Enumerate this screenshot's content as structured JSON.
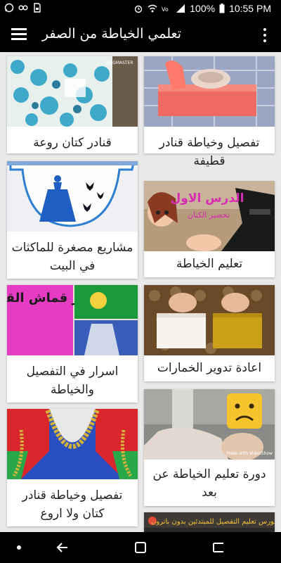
{
  "status_bar": {
    "time": "10:55 PM",
    "battery": "100%",
    "notification_icons": [
      "whatsapp-icon",
      "infinity-icon",
      "sim-card-icon",
      "alarm-icon",
      "wifi-icon",
      "volte-icon",
      "signal-icon",
      "battery-icon"
    ]
  },
  "app_bar": {
    "title": "تعلمي الخياطة من الصفر"
  },
  "cards": [
    {
      "title": "قنادر كتان روعة"
    },
    {
      "title": "تفصيل وخياطة قنادر قطيفة"
    },
    {
      "title": "مشاريع مصغرة للماكثات في البيت"
    },
    {
      "title": "تعليم الخياطة"
    },
    {
      "title": "اسرار في التفصيل والخياطة"
    },
    {
      "title": "اعادة تدوير الخمارات"
    },
    {
      "title": "تفصيل وخياطة قنادر كتان ولا اروع"
    },
    {
      "title": "دورة تعليم الخياطة عن بعد"
    }
  ],
  "thumbnail_texts": {
    "kingmaster": "KINGMASTER",
    "lesson_one": "الدرس الاول",
    "lesson_one_sub": "تحضير الكتان",
    "secrets": "اسرار قماش القطيفة",
    "made_with": "Made with VideoShow",
    "course_banner": "كورس تعليم التفصيل للمبتدئين بدون باترون"
  },
  "nav_bar": {
    "buttons": [
      "dot",
      "back",
      "recents",
      "home"
    ]
  }
}
